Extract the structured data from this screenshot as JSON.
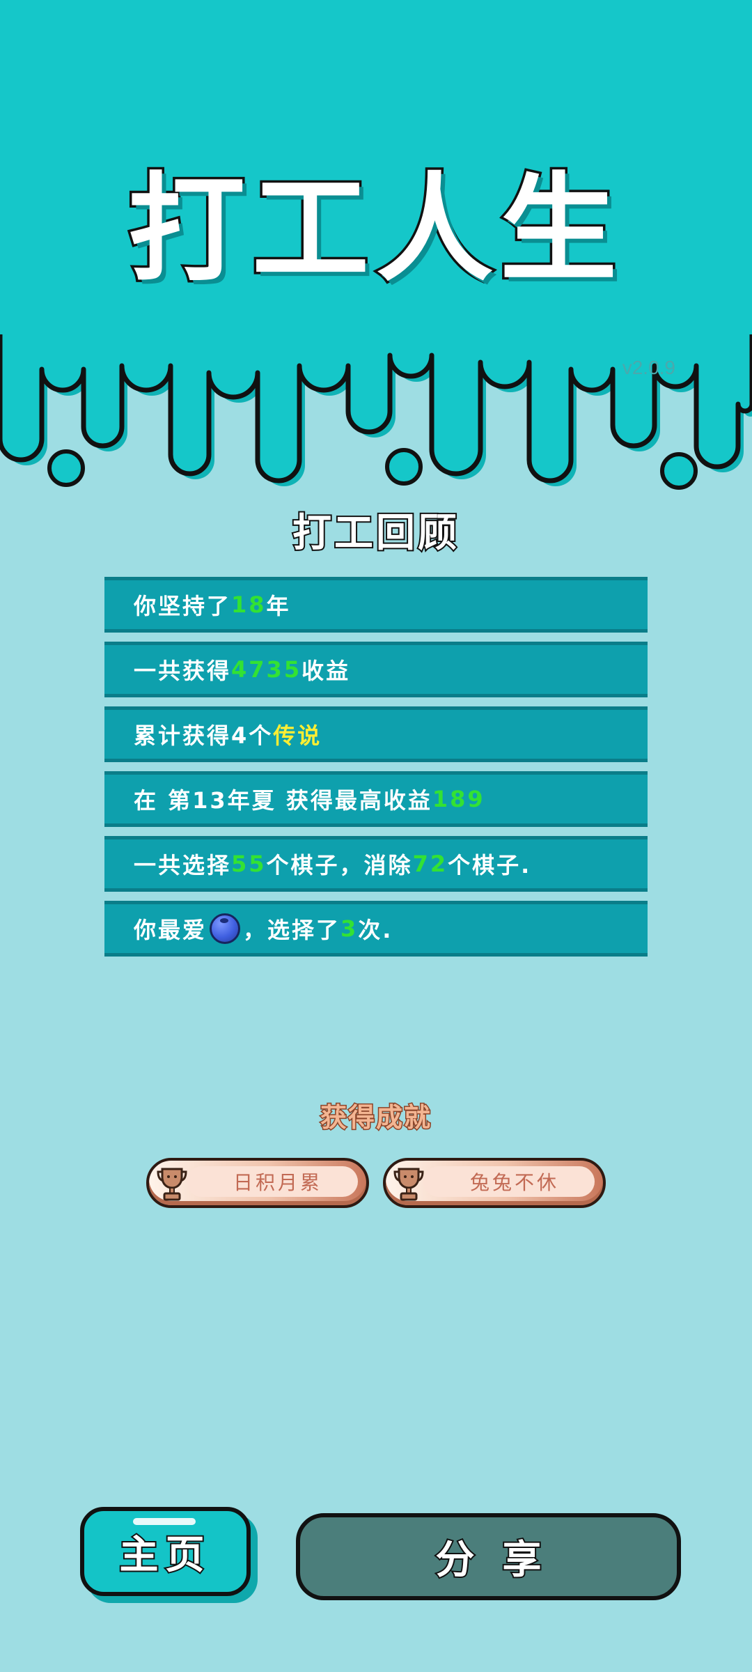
{
  "title": "打工人生",
  "version": "v2.0.9",
  "review": {
    "heading": "打工回顾",
    "rows": [
      {
        "parts": [
          {
            "text": "你坚持了"
          },
          {
            "text": "18",
            "style": "green"
          },
          {
            "text": "年"
          }
        ]
      },
      {
        "parts": [
          {
            "text": "一共获得"
          },
          {
            "text": "4735",
            "style": "green"
          },
          {
            "text": "收益"
          }
        ]
      },
      {
        "parts": [
          {
            "text": "累计获得4个"
          },
          {
            "text": "传说",
            "style": "yellow"
          }
        ]
      },
      {
        "parts": [
          {
            "text": "在 第13年夏 获得最高收益"
          },
          {
            "text": "189",
            "style": "green"
          }
        ]
      },
      {
        "parts": [
          {
            "text": "一共选择"
          },
          {
            "text": "55",
            "style": "green"
          },
          {
            "text": "个棋子，消除"
          },
          {
            "text": "72",
            "style": "green"
          },
          {
            "text": "个棋子."
          }
        ]
      },
      {
        "parts": [
          {
            "text": "你最爱"
          },
          {
            "icon": "blueberry-icon"
          },
          {
            "text": "，选择了"
          },
          {
            "text": "3",
            "style": "green"
          },
          {
            "text": "次."
          }
        ]
      }
    ]
  },
  "achievements": {
    "heading": "获得成就",
    "items": [
      {
        "label": "日积月累",
        "icon": "trophy-icon"
      },
      {
        "label": "兔兔不休",
        "icon": "trophy-icon"
      }
    ]
  },
  "buttons": {
    "home": "主页",
    "share": "分享"
  },
  "colors": {
    "top_band": "#15c7c9",
    "background": "#9edde3",
    "row": "#0ea0ad",
    "highlight_green": "#33e233",
    "highlight_yellow": "#ffee33",
    "share_button": "#4b7e7b"
  }
}
